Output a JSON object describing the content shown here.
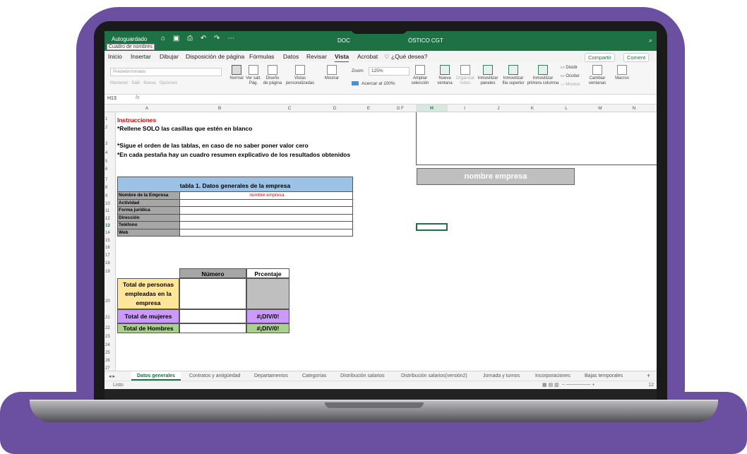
{
  "window": {
    "autosave": "Autoguardado",
    "namebox_tooltip": "Cuadro de nombres",
    "doc_left": "DOC",
    "doc_right": "ÓSTICO CGT",
    "qat_icons": [
      "home-icon",
      "save-icon",
      "print-icon",
      "undo-icon",
      "redo-icon",
      "more-icon"
    ]
  },
  "menu": {
    "items": [
      "Inicio",
      "Insertar",
      "Dibujar",
      "Disposición de página",
      "Fórmulas",
      "Datos",
      "Revisar",
      "Vista",
      "Acrobat"
    ],
    "active": "Vista",
    "tell_me": "¿Qué desea?",
    "share": "Compartir",
    "comment": "Coment"
  },
  "ribbon": {
    "preset": "Predeterminado",
    "keep": "Mantener",
    "exit": "Salir",
    "new": "Nueva",
    "options": "Opciones",
    "normal": "Normal",
    "page_break_1": "Ver salt.",
    "page_break_2": "Pág.",
    "page_layout_1": "Diseño",
    "page_layout_2": "de página",
    "custom_views_1": "Vistas",
    "custom_views_2": "personalizadas",
    "show": "Mostrar",
    "zoom_label": "Zoom",
    "zoom_value": "125%",
    "zoom_100": "Acercar al 100%",
    "zoom_sel_1": "Ampliar",
    "zoom_sel_2": "selección",
    "new_window_1": "Nueva",
    "new_window_2": "ventana",
    "arrange_1": "Organizar",
    "arrange_2": "todas",
    "freeze_1": "Inmovilizar",
    "freeze_2": "paneles",
    "freeze_top_1": "Inmovilizar",
    "freeze_top_2": "fila superior",
    "freeze_col_1": "Inmovilizar",
    "freeze_col_2": "primera columna",
    "split": "Dividir",
    "hide": "Ocultar",
    "unhide": "Mostrar",
    "switch_1": "Cambiar",
    "switch_2": "ventanas",
    "macros": "Macros"
  },
  "formula_bar": {
    "cell_ref": "H13",
    "fx": "fx"
  },
  "columns": [
    "A",
    "B",
    "C",
    "D",
    "E",
    "F",
    "G",
    "H",
    "I",
    "J",
    "K",
    "L",
    "M",
    "N"
  ],
  "selected_column": "H",
  "rows": [
    "1",
    "2",
    "3",
    "4",
    "5",
    "6",
    "7",
    "8",
    "9",
    "10",
    "11",
    "12",
    "13",
    "14",
    "15",
    "16",
    "17",
    "18",
    "19",
    "20",
    "21",
    "22",
    "23",
    "24",
    "25",
    "26",
    "27"
  ],
  "sheet": {
    "instructions_title": "Instrucciones",
    "line2": "*Rellene SOLO las casillas que estén en blanco",
    "line3": "*Sigue el orden de las tablas, en caso de no saber poner valor cero",
    "line4": "*En cada pestaña hay un cuadro resumen explicativo de los resultados obtenidos",
    "table1": {
      "title": "tabla 1. Datos generales de la empresa",
      "rows": [
        {
          "label": "Nombre de la Empresa",
          "value": "nombre empresa"
        },
        {
          "label": "Actividad",
          "value": ""
        },
        {
          "label": "Forma jurídica",
          "value": ""
        },
        {
          "label": "Dirección",
          "value": ""
        },
        {
          "label": "Teléfono",
          "value": ""
        },
        {
          "label": "Web",
          "value": ""
        }
      ]
    },
    "table2": {
      "col_number": "Número",
      "col_percent": "Prcentaje",
      "row_total": "Total de personas empleadas en la empresa",
      "row_women": "Total de mujeres",
      "row_men": "Total de Hombres",
      "women_percent": "#¡DIV/0!",
      "men_percent": "#¡DIV/0!"
    },
    "summary_box": "nombre empresa"
  },
  "tabs": {
    "items": [
      "Datos generales",
      "Contratos y antigüedad",
      "Departamentos",
      "Categorías",
      "Distribución salarios",
      "Distribución salarios(versión2)",
      "Jornada y turnos",
      "Incorporaciones",
      "Bajas temporales"
    ],
    "active": "Datos generales",
    "add": "+"
  },
  "status": {
    "ready": "Listo",
    "zoom": "12"
  },
  "colors": {
    "excel_green": "#1e7145",
    "table_blue": "#9cc2e5",
    "yellow": "#ffe699",
    "purple": "#cc99ff",
    "green": "#a9d08e",
    "frame_purple": "#6b4fa0"
  }
}
